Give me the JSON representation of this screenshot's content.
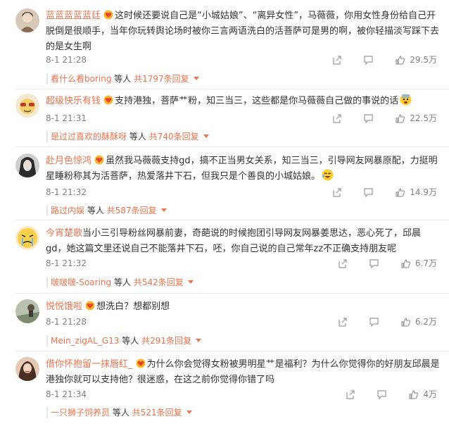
{
  "comments": [
    {
      "username": "蓝蓝蓝蓝蓝廷",
      "text": "这时候还要说自己是“小城姑娘”、“离异女性”，马薇薇，你用女性身份给自己开脱倒是很顺手，当年你玩转舆论场时被你三言两语洗白的活菩萨可是男的啊，被你轻描淡写踩下去的是女生啊",
      "time": "8-1 21:28",
      "likes": "29.5万",
      "reply_user": "看什么看boring",
      "reply_mid": "等人",
      "reply_count": "共1797条回复"
    },
    {
      "username": "超级快乐有钱",
      "text": "支持港独，菩萨艹粉，知三当三，这些都是你马薇薇自己做的事说的话",
      "time": "8-1 21:31",
      "likes": "22.5万",
      "reply_user": "是过过喜欢的酥酥呀",
      "reply_mid": "等人",
      "reply_count": "共740条回复"
    },
    {
      "username": "赴月色惊鸿",
      "text": "虽然我马薇薇支持gd，搞不正当男女关系，知三当三，引导网友网暴原配，力挺明星睡粉称其为活菩萨，热爱落井下石，但我只是个善良的小城姑娘。",
      "time": "8-1 21:32",
      "likes": "14.9万",
      "reply_user": "路过内娱",
      "reply_mid": "等人",
      "reply_count": "共587条回复"
    },
    {
      "username": "今宵楚歌",
      "text": "当小三引导粉丝网暴前妻，奇葩说的时候抱团引导网友网暴姜思达，恶心死了，邱晨gd，她这篇文里还说自己不能落井下石，呸，你自己说的自己常年zz不正确支持朋友呢",
      "time": "8-1 21:32",
      "likes": "6.7万",
      "reply_user": "啵啵啵-Soaring",
      "reply_mid": "等人",
      "reply_count": "共542条回复"
    },
    {
      "username": "悦悦饿啦",
      "text": "想洗白？想都别想",
      "time": "8-1 21:28",
      "likes": "6.2万",
      "reply_user": "Mein_zigAL_G13",
      "reply_mid": "等人",
      "reply_count": "共291条回复"
    },
    {
      "username": "借你怀抱留一抹唇红_",
      "text": "为什么你会觉得女粉被男明星艹是福利？为什么你觉得你的好朋友邱晨是港独你就可以支持他？很迷惑，在这之前你觉得你错了吗",
      "time": "8-1 21:34",
      "likes": "4万",
      "reply_user": "一只狮子饲养员",
      "reply_mid": "等人",
      "reply_count": "共521条回复"
    }
  ],
  "colors": {
    "username": "#eb7350",
    "meta": "#808080",
    "text": "#333333"
  },
  "icons": {
    "badge": "vip-heart-badge-icon",
    "share": "share-icon",
    "comment": "comment-icon",
    "like": "thumbs-up-icon",
    "emoji_fear": "fearful-emoji-icon",
    "emoji_laugh": "laughing-emoji-icon"
  }
}
